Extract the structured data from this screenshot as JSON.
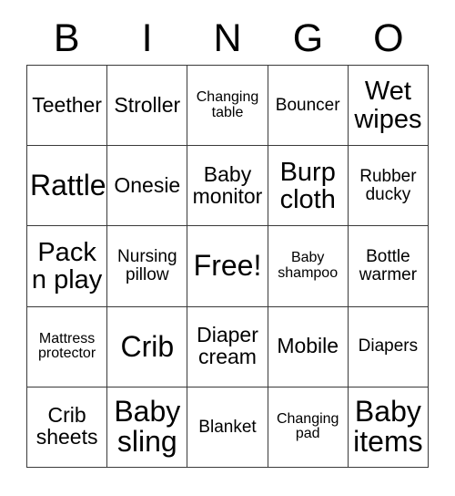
{
  "card": {
    "title": "BINGO",
    "header_letters": [
      "B",
      "I",
      "N",
      "G",
      "O"
    ],
    "free_space_label": "Free!",
    "colors": {
      "background": "#ffffff",
      "border": "#3a3a3a",
      "text": "#000000"
    },
    "grid_size": "5x5"
  },
  "grid": {
    "rows": [
      [
        {
          "label": "Teether",
          "size": "md",
          "free": false
        },
        {
          "label": "Stroller",
          "size": "md",
          "free": false
        },
        {
          "label": "Changing table",
          "size": "xs",
          "free": false
        },
        {
          "label": "Bouncer",
          "size": "sm",
          "free": false
        },
        {
          "label": "Wet wipes",
          "size": "lg",
          "free": false
        }
      ],
      [
        {
          "label": "Rattle",
          "size": "xl",
          "free": false
        },
        {
          "label": "Onesie",
          "size": "md",
          "free": false
        },
        {
          "label": "Baby monitor",
          "size": "md",
          "free": false
        },
        {
          "label": "Burp cloth",
          "size": "lg",
          "free": false
        },
        {
          "label": "Rubber ducky",
          "size": "sm",
          "free": false
        }
      ],
      [
        {
          "label": "Pack n play",
          "size": "lg",
          "free": false
        },
        {
          "label": "Nursing pillow",
          "size": "sm",
          "free": false
        },
        {
          "label": "Free!",
          "size": "xl",
          "free": true
        },
        {
          "label": "Baby shampoo",
          "size": "xs",
          "free": false
        },
        {
          "label": "Bottle warmer",
          "size": "sm",
          "free": false
        }
      ],
      [
        {
          "label": "Mattress protector",
          "size": "xs",
          "free": false
        },
        {
          "label": "Crib",
          "size": "xl",
          "free": false
        },
        {
          "label": "Diaper cream",
          "size": "md",
          "free": false
        },
        {
          "label": "Mobile",
          "size": "md",
          "free": false
        },
        {
          "label": "Diapers",
          "size": "sm",
          "free": false
        }
      ],
      [
        {
          "label": "Crib sheets",
          "size": "md",
          "free": false
        },
        {
          "label": "Baby sling",
          "size": "xl",
          "free": false
        },
        {
          "label": "Blanket",
          "size": "sm",
          "free": false
        },
        {
          "label": "Changing pad",
          "size": "xs",
          "free": false
        },
        {
          "label": "Baby items",
          "size": "xl",
          "free": false
        }
      ]
    ]
  }
}
